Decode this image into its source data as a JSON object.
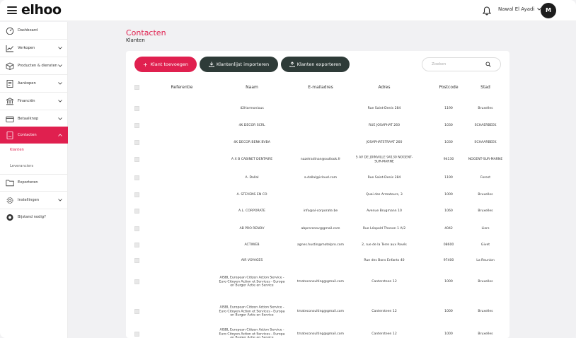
{
  "app": {
    "logo": "elhoo",
    "user_name": "Nawal El Ayadi",
    "avatar_initials": "M"
  },
  "colors": {
    "accent": "#e0204f",
    "dark_button": "#2e3b38"
  },
  "sidebar": {
    "items": [
      {
        "label": "Dashboard",
        "icon": "gauge-icon",
        "chevron": false
      },
      {
        "label": "Verkopen",
        "icon": "trend-chart-icon",
        "chevron": true
      },
      {
        "label": "Producten & diensten",
        "icon": "box-icon",
        "chevron": true
      },
      {
        "label": "Aankopen",
        "icon": "document-icon",
        "chevron": true
      },
      {
        "label": "Financiën",
        "icon": "bank-icon",
        "chevron": true
      },
      {
        "label": "Betaalknop",
        "icon": "card-icon",
        "chevron": true
      },
      {
        "label": "Contacten",
        "icon": "contacts-icon",
        "chevron": true,
        "active": true
      },
      {
        "label": "Exporteren",
        "icon": "folder-icon",
        "chevron": false
      },
      {
        "label": "Instellingen",
        "icon": "gear-icon",
        "chevron": true
      },
      {
        "label": "Bijstand nodig?",
        "icon": "lifebuoy-icon",
        "chevron": false
      }
    ],
    "subitems": [
      {
        "label": "Klanten",
        "active": true
      },
      {
        "label": "Leveranciers",
        "active": false
      }
    ]
  },
  "header": {
    "title": "Contacten",
    "subtitle": "Klanten"
  },
  "toolbar": {
    "add_label": "Klant toevoegen",
    "import_label": "Klantenlijst importeren",
    "export_label": "Klanten exporteren",
    "search_placeholder": "Zoeken"
  },
  "table": {
    "columns": [
      "Referentie",
      "Naam",
      "E-mailadres",
      "Adres",
      "Postcode",
      "Stad"
    ],
    "rows": [
      {
        "ref": "",
        "name": "42Harmonious",
        "email": "",
        "address": "Rue Saint-Denis 284",
        "postcode": "1190",
        "city": "Bruxelles"
      },
      {
        "ref": "",
        "name": "4K DECOR SCRL",
        "email": "",
        "address": "RUE JOSAPHAT 260",
        "postcode": "1030",
        "city": "SCHAERBEEK"
      },
      {
        "ref": "",
        "name": "4K DECOR BENK BVBA",
        "email": "",
        "address": "JOSAPHATSTRAAT 260",
        "postcode": "1030",
        "city": "SCHAARBEEK"
      },
      {
        "ref": "",
        "name": "A X B CABINET DENTAIRE",
        "email": "nazelradinan@outlook.fr",
        "address": "5 AV DE JOINVILLE 94130 NOGENT-SUR-MARNE",
        "postcode": "94130",
        "city": "NOGENT-SUR-MARNE"
      },
      {
        "ref": "",
        "name": "A. Dallal",
        "email": "a.dallal@icloud.com",
        "address": "Rue Saint-Denis 284",
        "postcode": "1190",
        "city": "Forest"
      },
      {
        "ref": "",
        "name": "A. STEVENS EN CO",
        "email": "",
        "address": "Quai des Armateurs, 3",
        "postcode": "1000",
        "city": "Bruxelles"
      },
      {
        "ref": "",
        "name": "A.L. CORPORATE",
        "email": "info@al-corporate.be",
        "address": "Avenue Brugmann 10",
        "postcode": "1060",
        "city": "Bruxelles"
      },
      {
        "ref": "",
        "name": "AB PRO RENOV",
        "email": "abprorenov@gmail.com",
        "address": "Rue Léopold Thonon 1 A/2",
        "postcode": "4042",
        "city": "Liers"
      },
      {
        "ref": "",
        "name": "ACTIWEB",
        "email": "agnes.hustin@motelpro.com",
        "address": "2, rue de la Terre aux Pavés",
        "postcode": "08600",
        "city": "Givet"
      },
      {
        "ref": "",
        "name": "AIR VOYAGES",
        "email": "",
        "address": "Rue des Bons Enfants 40",
        "postcode": "97400",
        "city": "La Reunion"
      },
      {
        "ref": "",
        "name": "AISBL European Citizen Action Service - Euro Citoyen Action et Services - Europa en Burger Actie en Service",
        "email": "tmateconsulting@gmail.com",
        "address": "Cantersteen 12",
        "postcode": "1000",
        "city": "Bruxelles"
      },
      {
        "ref": "",
        "name": "AISBL European Citizen Action Service - Euro Citoyen Action et Services - Europa en Burger Actie en Service",
        "email": "tmateconsulting@gmail.com",
        "address": "Cantersteen 12",
        "postcode": "1000",
        "city": "Bruxelles"
      },
      {
        "ref": "",
        "name": "AISBL European Citizen Action Service - Euro Citoyen Action et Services - Europa en Burger Actie en Service",
        "email": "tmateconsulting@gmail.com",
        "address": "Cantersteen 12",
        "postcode": "1000",
        "city": "Bruxelles"
      }
    ]
  }
}
